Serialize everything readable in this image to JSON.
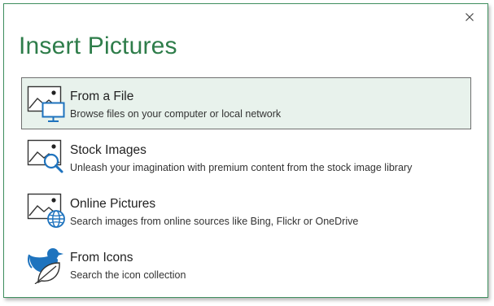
{
  "dialog": {
    "title": "Insert Pictures",
    "close_label": "×"
  },
  "options": [
    {
      "label": "From a File",
      "description": "Browse files on your computer or local network",
      "icon": "picture-computer-icon",
      "selected": true
    },
    {
      "label": "Stock Images",
      "description": "Unleash your imagination with premium content from the stock image library",
      "icon": "picture-search-icon",
      "selected": false
    },
    {
      "label": "Online Pictures",
      "description": "Search images from online sources like Bing, Flickr or OneDrive",
      "icon": "picture-globe-icon",
      "selected": false
    },
    {
      "label": "From Icons",
      "description": "Search the icon collection",
      "icon": "bird-leaf-icon",
      "selected": false
    }
  ],
  "colors": {
    "accent": "#2e7d4a",
    "icon_blue": "#1e73be",
    "selected_bg": "#e8f2ec"
  }
}
